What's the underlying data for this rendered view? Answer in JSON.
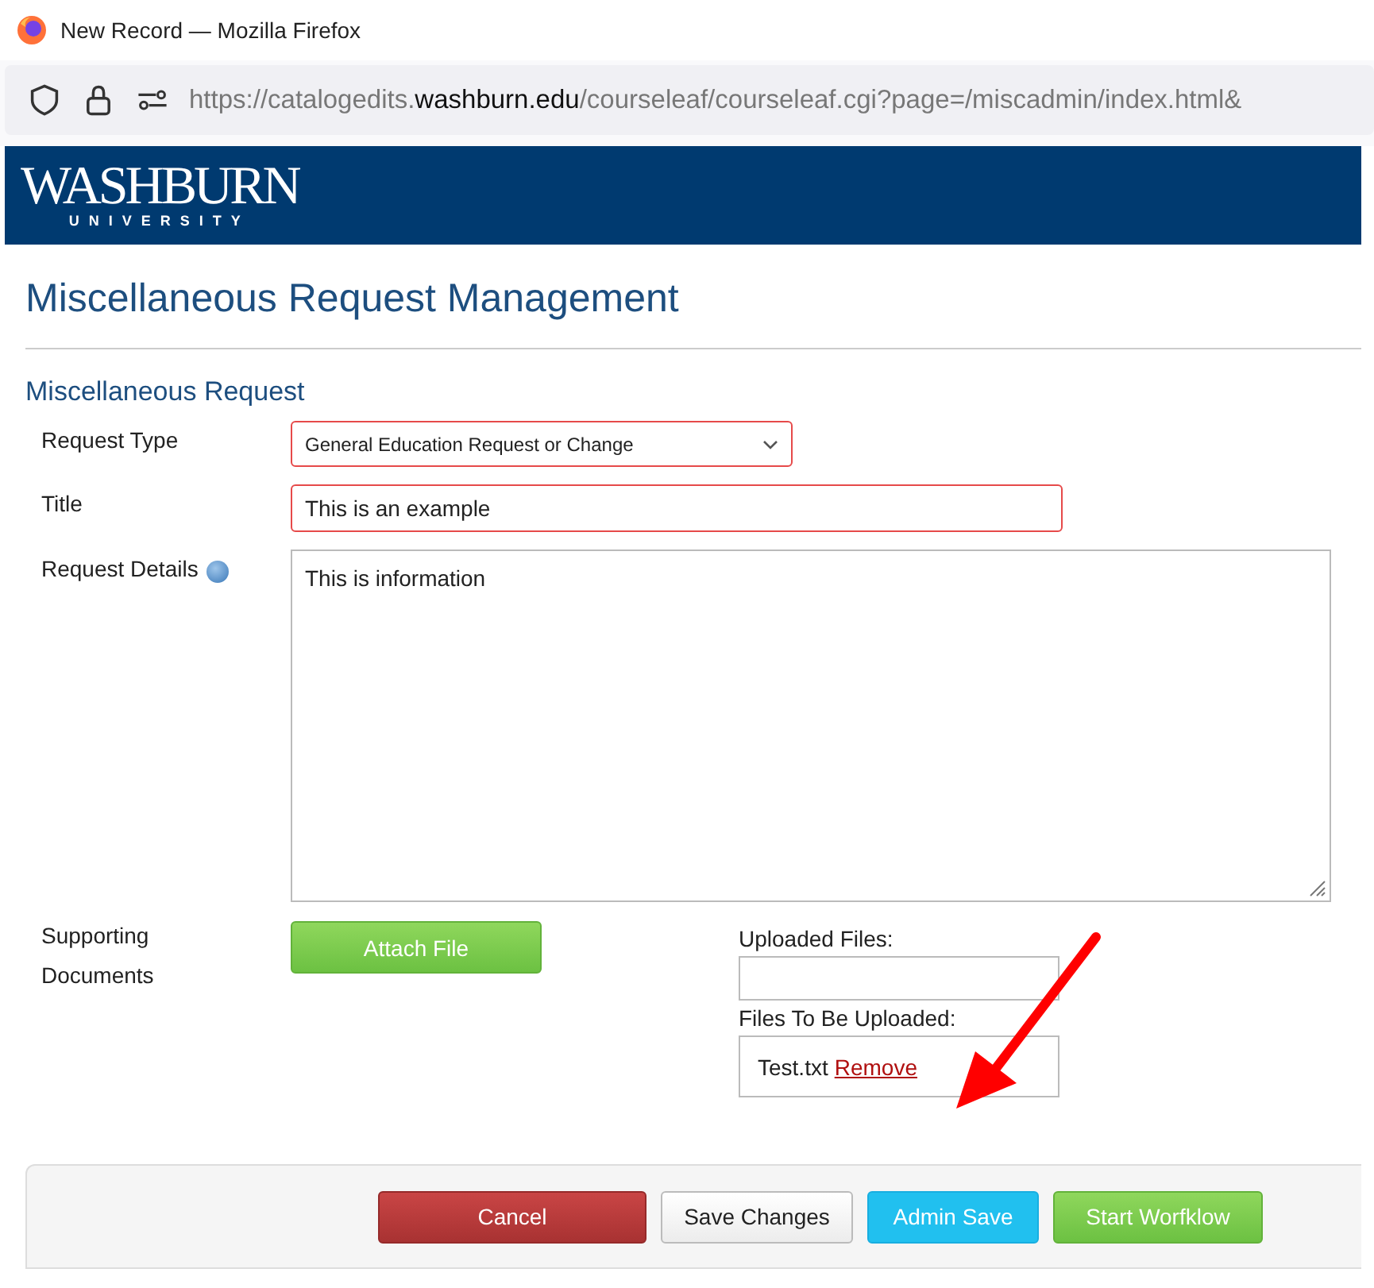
{
  "window": {
    "title": "New Record — Mozilla Firefox"
  },
  "address_bar": {
    "url": "https://catalogedits.**washburn.edu**/courseleaf/courseleaf.cgi?page=/miscadmin/index.html&"
  },
  "banner": {
    "logo_name": "WASHBURN",
    "logo_sub": "UNIVERSITY"
  },
  "page_title": "Miscellaneous Request Management",
  "section_title": "Miscellaneous Request",
  "fields": [
    {
      "kind": "select",
      "label": "Request Type",
      "value": "General Education Request or Change",
      "invalid": true
    },
    {
      "kind": "text",
      "label": "Title",
      "value": "This is an example",
      "invalid": true
    },
    {
      "kind": "textarea",
      "label": "Request Details",
      "value": "This is information",
      "invalid": false,
      "help": true
    }
  ],
  "documents": {
    "label": "Supporting Documents",
    "attach_button": "Attach File",
    "uploaded_label": "Uploaded Files:",
    "pending_label": "Files To Be Uploaded:",
    "pending_files": [
      {
        "name": "Test.txt",
        "action": "Remove"
      }
    ]
  },
  "buttons": [
    {
      "label": "Cancel",
      "kind": "danger"
    },
    {
      "label": "Save Changes",
      "kind": "default"
    },
    {
      "label": "Admin Save",
      "kind": "info"
    },
    {
      "label": "Start Worfklow",
      "kind": "success"
    }
  ]
}
